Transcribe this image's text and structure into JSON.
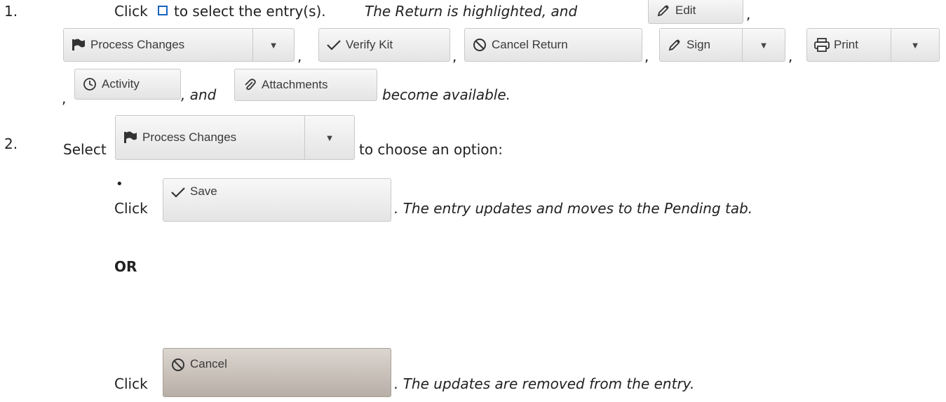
{
  "steps": [
    {
      "number": "1.",
      "t_click": "Click",
      "t_select": "to select the entry(s).",
      "t_highlight": "The Return is highlighted, and",
      "t_and": ", and",
      "t_become": "become available.",
      "comma": ","
    },
    {
      "number": "2.",
      "t_select": "Select",
      "t_choose": "to choose an option:"
    }
  ],
  "buttons": {
    "edit": "Edit",
    "process_changes": "Process Changes",
    "verify_kit": "Verify Kit",
    "cancel_return": "Cancel Return",
    "sign": "Sign",
    "print": "Print",
    "activity": "Activity",
    "attachments": "Attachments",
    "save": "Save",
    "cancel": "Cancel",
    "caret": "▼"
  },
  "options": {
    "bullet": "•",
    "click": "Click",
    "save_result": ". The entry updates and moves to the Pending tab.",
    "or": "OR",
    "cancel_result": ". The updates are removed from the entry."
  }
}
